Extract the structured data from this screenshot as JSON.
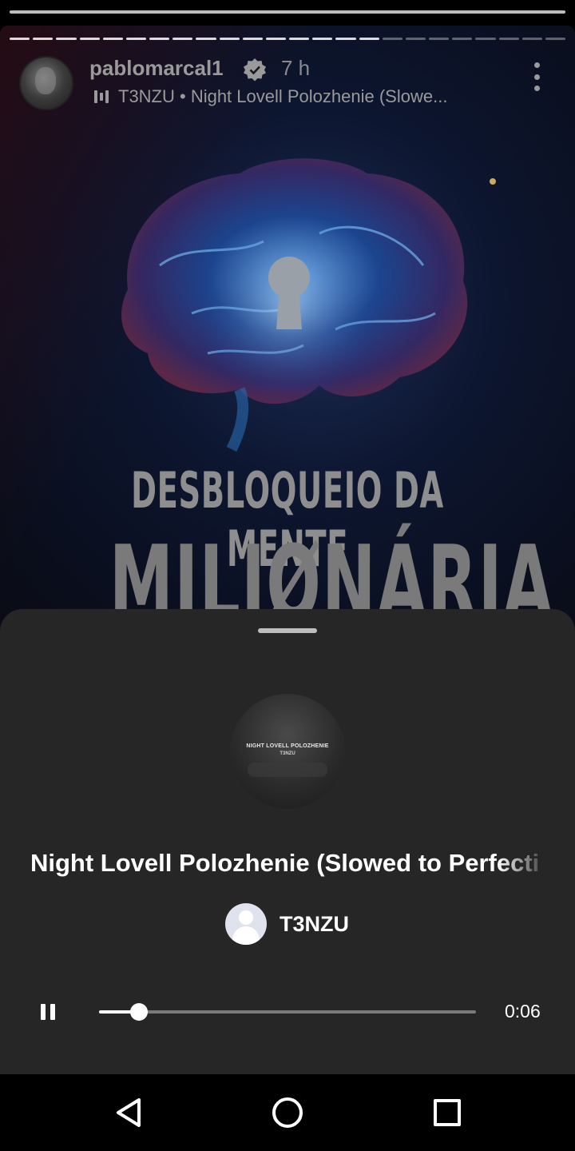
{
  "story": {
    "username": "pablomarcal1",
    "time_ago": "7 h",
    "music_text": "T3NZU • Night Lovell Polozhenie (Slowe...",
    "segments_total": 24,
    "segments_done": 16,
    "promo_line1": "DESBLOQUEIO DA MENTE",
    "promo_line2": "MILIØNÁRIA",
    "icons": [
      "verified-icon",
      "music-bars-icon",
      "more-options-icon"
    ]
  },
  "player": {
    "cover_text_1": "NIGHT LOVELL POLOZHENIE",
    "cover_text_2": "T3NZU",
    "track_title": "Night Lovell Polozhenie (Slowed to Perfecti",
    "artist": "T3NZU",
    "elapsed": "0:06",
    "progress_fraction": 0.105,
    "state": "playing"
  },
  "navigation": {
    "buttons": [
      "back",
      "home",
      "recents"
    ]
  },
  "colors": {
    "sheet_bg": "#262626",
    "nav_bg": "#000000",
    "accent": "#ffffff",
    "track_bg": "#7a7a7a"
  }
}
